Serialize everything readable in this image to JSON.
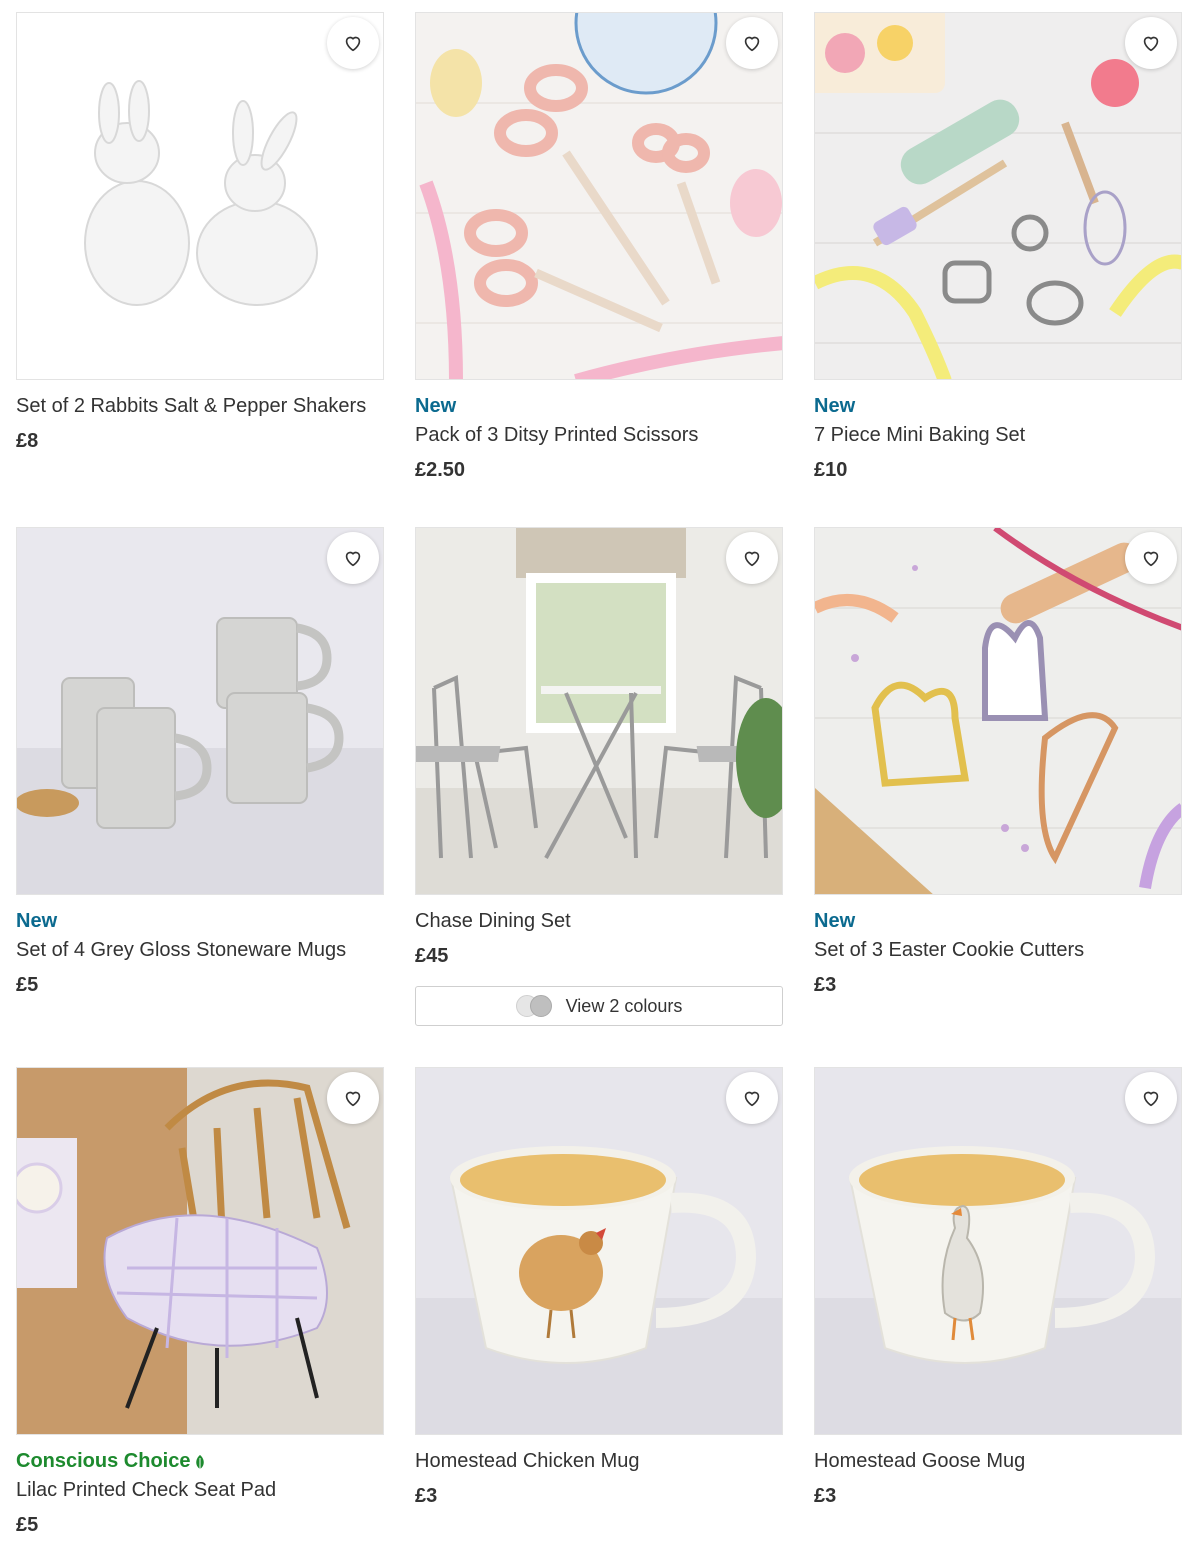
{
  "products": [
    {
      "badge": "",
      "title": "Set of 2 Rabbits Salt & Pepper Shakers",
      "price": "£8",
      "image": "white-ceramic-rabbits"
    },
    {
      "badge": "New",
      "title": "Pack of 3 Ditsy Printed Scissors",
      "price": "£2.50",
      "image": "pink-scissors"
    },
    {
      "badge": "New",
      "title": "7 Piece Mini Baking Set",
      "price": "£10",
      "image": "mini-baking-tools"
    },
    {
      "badge": "New",
      "title": "Set of 4 Grey Gloss Stoneware Mugs",
      "price": "£5",
      "image": "grey-mugs"
    },
    {
      "badge": "",
      "title": "Chase Dining Set",
      "price": "£45",
      "image": "folding-dining-set",
      "colours_label": "View 2 colours"
    },
    {
      "badge": "New",
      "title": "Set of 3 Easter Cookie Cutters",
      "price": "£3",
      "image": "easter-cookie-cutters"
    },
    {
      "badge": "Conscious Choice",
      "title": "Lilac Printed Check Seat Pad",
      "price": "£5",
      "image": "lilac-seat-pad"
    },
    {
      "badge": "",
      "title": "Homestead Chicken Mug",
      "price": "£3",
      "image": "chicken-mug"
    },
    {
      "badge": "",
      "title": "Homestead Goose Mug",
      "price": "£3",
      "image": "goose-mug"
    }
  ],
  "colors": {
    "badge_new": "#0b6a8f",
    "badge_conscious": "#1d8a2e",
    "text": "#333333"
  },
  "icons": {
    "favourite": "heart-outline-icon",
    "conscious": "leaf-icon"
  }
}
